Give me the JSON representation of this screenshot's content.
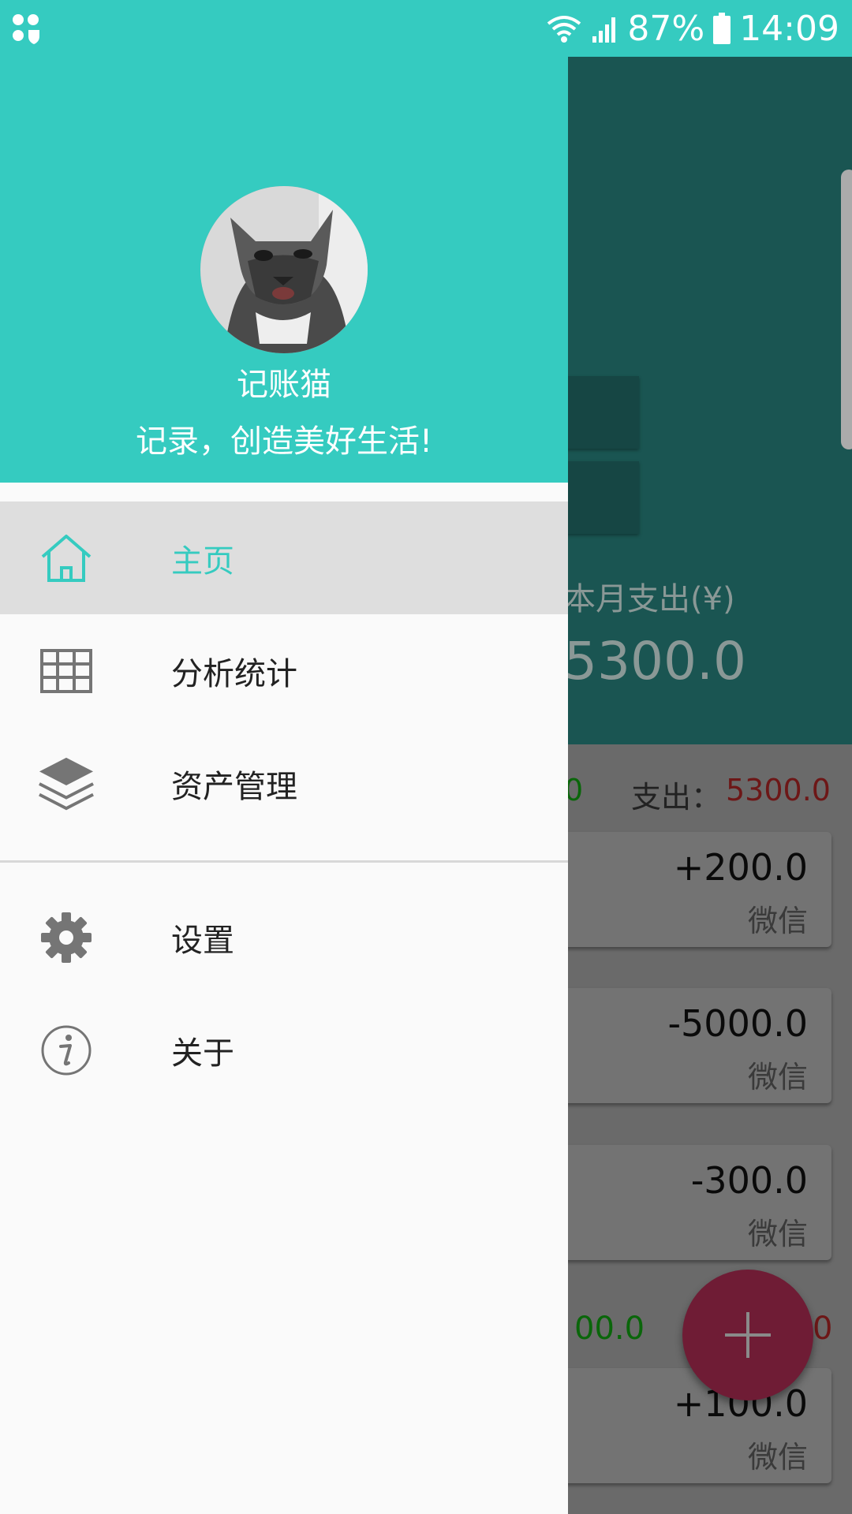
{
  "status_bar": {
    "battery_percent": "87%",
    "time": "14:09",
    "icons": [
      "notification-dots-icon",
      "wifi-icon",
      "signal-icon",
      "battery-icon"
    ]
  },
  "drawer": {
    "app_name": "记账猫",
    "slogan": "记录，创造美好生活!",
    "avatar": "cat-avatar",
    "menu": [
      {
        "label": "主页",
        "icon": "home-icon",
        "active": true
      },
      {
        "label": "分析统计",
        "icon": "grid-table-icon",
        "active": false
      },
      {
        "label": "资产管理",
        "icon": "layers-icon",
        "active": false
      },
      {
        "label": "设置",
        "icon": "gear-icon",
        "active": false
      },
      {
        "label": "关于",
        "icon": "info-icon",
        "active": false
      }
    ]
  },
  "background": {
    "month_expense_label": "本月支出(¥)",
    "month_expense_value": "5300.0",
    "summary_income_partial": "0",
    "summary_expense_label": "支出：",
    "summary_expense_value": "5300.0",
    "records": [
      {
        "amount": "+200.0",
        "source": "微信"
      },
      {
        "amount": "-5000.0",
        "source": "微信"
      },
      {
        "amount": "-300.0",
        "source": "微信"
      },
      {
        "amount": "+100.0",
        "source": "微信"
      }
    ],
    "daily_income_partial": "00.0",
    "daily_expense_partial": "0"
  },
  "colors": {
    "accent": "#35cbc0",
    "drawer_bg": "#fafafa",
    "active_item_bg": "#dedede",
    "icon_gray": "#757575",
    "fab": "#6f1c35"
  }
}
